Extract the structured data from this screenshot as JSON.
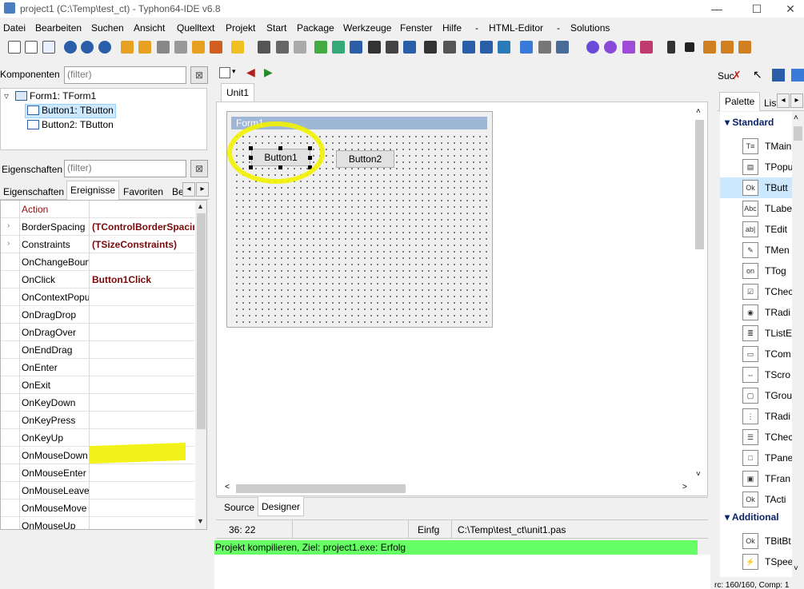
{
  "window": {
    "title": "project1 (C:\\Temp\\test_ct) - Typhon64-IDE v6.8",
    "minimize": "—",
    "maximize": "☐",
    "close": "✕"
  },
  "menu": [
    "Datei",
    "Bearbeiten",
    "Suchen",
    "Ansicht",
    "Quelltext",
    "Projekt",
    "Start",
    "Package",
    "Werkzeuge",
    "Fenster",
    "Hilfe",
    "-",
    "HTML-Editor",
    "-",
    "Solutions"
  ],
  "components": {
    "label": "Komponenten",
    "filter_placeholder": "(filter)",
    "tree": [
      {
        "label": "Form1: TForm1"
      },
      {
        "label": "Button1: TButton"
      },
      {
        "label": "Button2: TButton"
      }
    ]
  },
  "properties": {
    "label": "Eigenschaften",
    "filter_placeholder": "(filter)",
    "tabs": [
      "Eigenschaften",
      "Ereignisse",
      "Favoriten",
      "Be"
    ],
    "rows": [
      {
        "name": "Action",
        "value": ""
      },
      {
        "name": "BorderSpacing",
        "value": "(TControlBorderSpacing)"
      },
      {
        "name": "Constraints",
        "value": "(TSizeConstraints)"
      },
      {
        "name": "OnChangeBounds",
        "value": ""
      },
      {
        "name": "OnClick",
        "value": "Button1Click"
      },
      {
        "name": "OnContextPopup",
        "value": ""
      },
      {
        "name": "OnDragDrop",
        "value": ""
      },
      {
        "name": "OnDragOver",
        "value": ""
      },
      {
        "name": "OnEndDrag",
        "value": ""
      },
      {
        "name": "OnEnter",
        "value": ""
      },
      {
        "name": "OnExit",
        "value": ""
      },
      {
        "name": "OnKeyDown",
        "value": ""
      },
      {
        "name": "OnKeyPress",
        "value": ""
      },
      {
        "name": "OnKeyUp",
        "value": ""
      },
      {
        "name": "OnMouseDown",
        "value": ""
      },
      {
        "name": "OnMouseEnter",
        "value": ""
      },
      {
        "name": "OnMouseLeave",
        "value": ""
      },
      {
        "name": "OnMouseMove",
        "value": ""
      },
      {
        "name": "OnMouseUp",
        "value": ""
      }
    ]
  },
  "editor": {
    "file_tab": "Unit1",
    "form_title": "Form1",
    "button1": "Button1",
    "button2": "Button2",
    "bottom_tabs": [
      "Source",
      "Designer"
    ],
    "status": {
      "pos": "36: 22",
      "mode": "Einfg",
      "file": "C:\\Temp\\test_ct\\unit1.pas"
    },
    "message": "Projekt kompilieren, Ziel: project1.exe: Erfolg"
  },
  "palette": {
    "search_label": "Suc",
    "tabs": [
      "Palette",
      "Liste"
    ],
    "groups": [
      {
        "name": "Standard",
        "items": [
          {
            "icon": "T≡",
            "label": "TMain"
          },
          {
            "icon": "▤",
            "label": "TPopu"
          },
          {
            "icon": "Ok",
            "label": "TButt"
          },
          {
            "icon": "Abc",
            "label": "TLabe"
          },
          {
            "icon": "ab|",
            "label": "TEdit"
          },
          {
            "icon": "✎",
            "label": "TMen"
          },
          {
            "icon": "on",
            "label": "TTog"
          },
          {
            "icon": "☑",
            "label": "TChec"
          },
          {
            "icon": "◉",
            "label": "TRadi"
          },
          {
            "icon": "≣",
            "label": "TListE"
          },
          {
            "icon": "▭",
            "label": "TCom"
          },
          {
            "icon": "⇔",
            "label": "TScro"
          },
          {
            "icon": "▢",
            "label": "TGrou"
          },
          {
            "icon": "⋮",
            "label": "TRadi"
          },
          {
            "icon": "☰",
            "label": "TChec"
          },
          {
            "icon": "□",
            "label": "TPane"
          },
          {
            "icon": "▣",
            "label": "TFran"
          },
          {
            "icon": "Ok",
            "label": "TActi"
          }
        ]
      },
      {
        "name": "Additional",
        "items": [
          {
            "icon": "Ok",
            "label": "TBitBt"
          },
          {
            "icon": "⚡",
            "label": "TSpee"
          }
        ]
      }
    ],
    "footer": "rc: 160/160, Comp: 1"
  },
  "colors": {
    "highlight": "#f2f200",
    "success": "#66ff66",
    "form_caption": "#9fb7d6",
    "selection": "#cce8ff"
  }
}
